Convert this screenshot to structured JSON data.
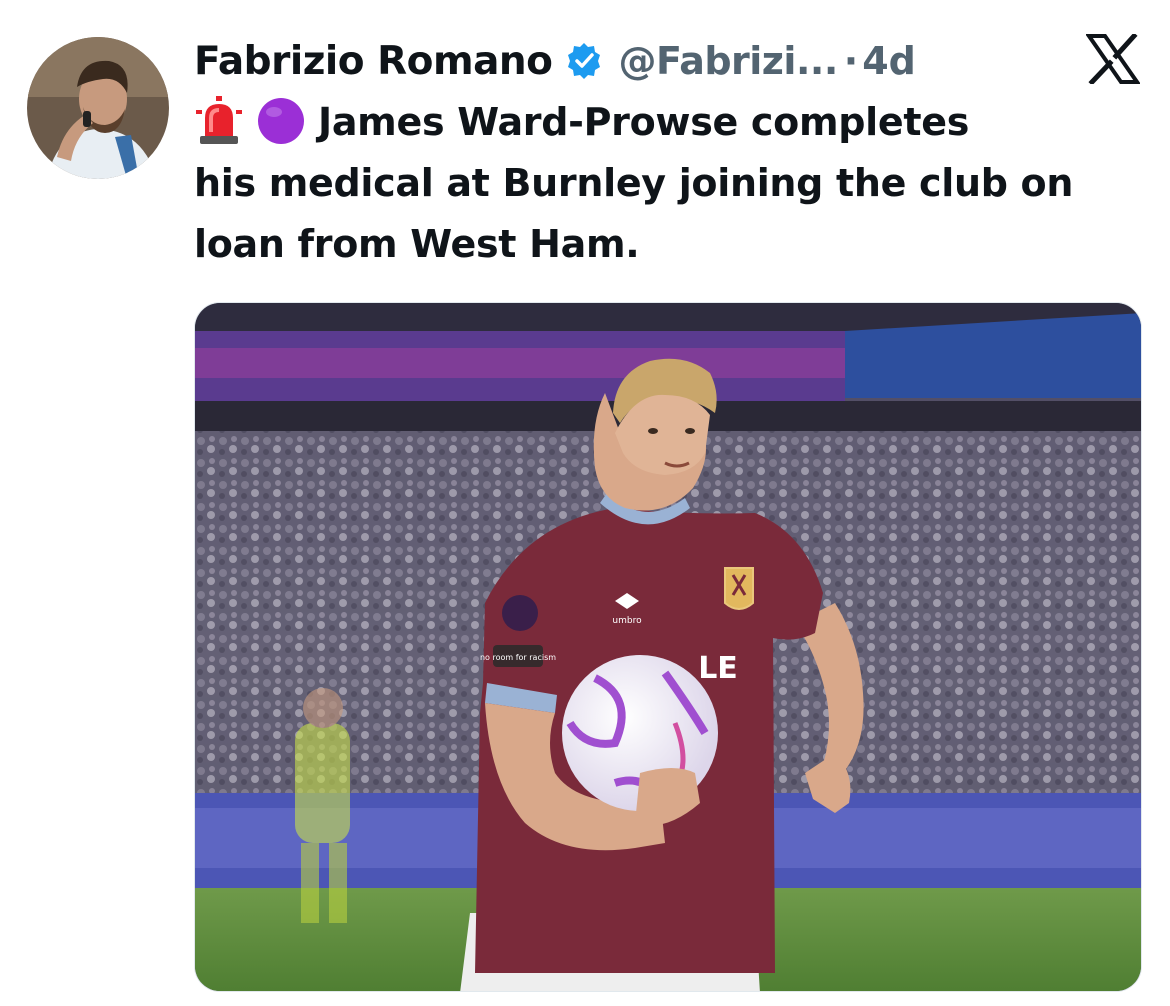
{
  "author": {
    "name": "Fabrizio Romano",
    "handle": "@Fabrizi...",
    "separator": "·",
    "time": "4d",
    "verified": true,
    "verified_color": "#1d9bf0",
    "avatar_icon": "person-photo"
  },
  "tweet": {
    "emojis": [
      "rotating-light-emoji",
      "purple-circle-emoji"
    ],
    "text_line1": "James Ward-Prowse completes",
    "text_line2": "his medical at Burnley joining the club on",
    "text_line3": "loan from West Ham."
  },
  "media": {
    "kit_text": "umbro",
    "shirt_sponsor_text": "LE",
    "sleeve_text": "no room for racism"
  },
  "brand": {
    "logo_icon": "x-logo-icon",
    "text_color": "#0f1419",
    "muted_color": "#536471",
    "claret": "#7a2a3a"
  }
}
